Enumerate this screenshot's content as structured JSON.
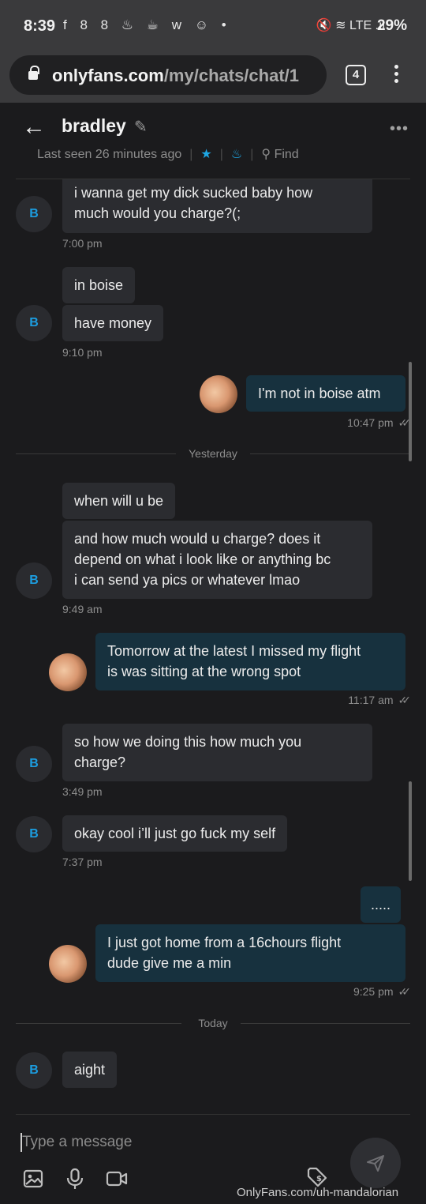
{
  "status_bar": {
    "time": "8:39",
    "notification_icons": "f 8 8 ♨ ☕ w ☺ •",
    "network_icons": "🔇 ≋ LTE .ıl",
    "battery": "29%"
  },
  "browser": {
    "url_host": "onlyfans.com",
    "url_path": "/my/chats/chat/1",
    "tab_count": "4"
  },
  "chat_header": {
    "name": "bradley",
    "last_seen": "Last seen 26 minutes ago",
    "find_label": "Find"
  },
  "avatar_initial": "B",
  "messages": [
    {
      "from": "them",
      "lines": [
        "i wanna get my dick sucked baby how",
        "much would you charge?(;"
      ],
      "time": "7:00 pm"
    },
    {
      "from": "them",
      "lines": [
        "in boise"
      ]
    },
    {
      "from": "them",
      "lines": [
        "have money"
      ],
      "time": "9:10 pm"
    },
    {
      "from": "me",
      "lines": [
        "I'm not in boise atm"
      ],
      "time": "10:47 pm"
    },
    {
      "from": "them",
      "lines": [
        "when will u be"
      ]
    },
    {
      "from": "them",
      "lines": [
        "and how much would u charge? does it",
        "depend on what i look like or anything bc",
        "i can send ya pics or whatever lmao"
      ],
      "time": "9:49 am"
    },
    {
      "from": "me",
      "lines": [
        "Tomorrow at the latest I missed my flight",
        "is was sitting at the wrong spot"
      ],
      "time": "11:17 am"
    },
    {
      "from": "them",
      "lines": [
        "so how we doing this how much you",
        "charge?"
      ],
      "time": "3:49 pm"
    },
    {
      "from": "them",
      "lines": [
        "okay cool i’ll just go fuck my self"
      ],
      "time": "7:37 pm"
    },
    {
      "from": "me",
      "lines": [
        "....."
      ]
    },
    {
      "from": "me",
      "lines": [
        "I just got home from a 16chours flight",
        "dude give me a min"
      ],
      "time": "9:25 pm"
    },
    {
      "from": "them",
      "lines": [
        "aight"
      ]
    }
  ],
  "day_separators": {
    "yesterday": "Yesterday",
    "today": "Today"
  },
  "composer": {
    "placeholder": "Type a message"
  },
  "watermark": "OnlyFans.com/uh-mandalorian",
  "colors": {
    "accent": "#1ea7e4",
    "background": "#1b1b1d",
    "incoming_bubble": "#2b2c30",
    "outgoing_bubble": "#17313e"
  }
}
